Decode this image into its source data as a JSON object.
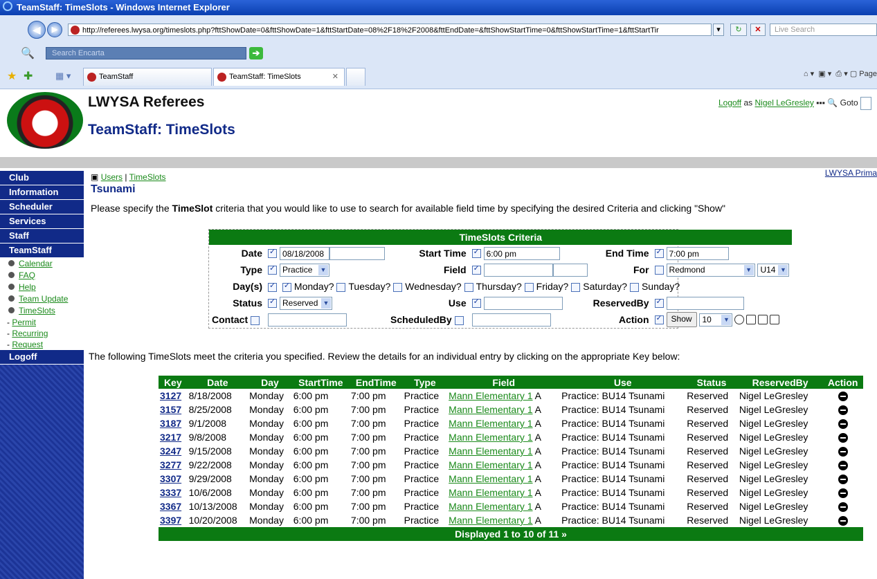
{
  "window": {
    "title": "TeamStaff: TimeSlots - Windows Internet Explorer"
  },
  "browser": {
    "url": "http://referees.lwysa.org/timeslots.php?fttShowDate=0&fttShowDate=1&fttStartDate=08%2F18%2F2008&fttEndDate=&fttShowStartTime=0&fttShowStartTime=1&fttStartTir",
    "live_search_placeholder": "Live Search",
    "encarta_placeholder": "Search Encarta",
    "tabs": [
      {
        "label": "TeamStaff"
      },
      {
        "label": "TeamStaff: TimeSlots"
      }
    ],
    "page_menu": "Page"
  },
  "header": {
    "site": "LWYSA Referees",
    "page_title": "TeamStaff: TimeSlots",
    "logoff": "Logoff",
    "as": "as",
    "user": "Nigel LeGresley",
    "goto": "Goto",
    "primary_link": "LWYSA Prima"
  },
  "sidebar": {
    "heads": [
      "Club",
      "Information",
      "Scheduler",
      "Services",
      "Staff",
      "TeamStaff"
    ],
    "items": [
      "Calendar",
      "FAQ",
      "Help",
      "Team Update",
      "TimeSlots"
    ],
    "subs": [
      "Permit",
      "Recurring",
      "Request"
    ],
    "logoff": "Logoff"
  },
  "main": {
    "crumb_users": "Users",
    "crumb_sep": "|",
    "crumb_timeslots": "TimeSlots",
    "team": "Tsunami",
    "intro_pre": "Please specify the ",
    "intro_bold": "TimeSlot",
    "intro_post": " criteria that you would like to use to search for available field time by specifying the desired Criteria and clicking \"Show\"",
    "summary": "The following TimeSlots meet the criteria you specified. Review the details for an individual entry by clicking on the appropriate Key below:"
  },
  "criteria": {
    "title": "TimeSlots Criteria",
    "date_label": "Date",
    "date_value": "08/18/2008",
    "start_label": "Start Time",
    "start_value": "6:00 pm",
    "end_label": "End Time",
    "end_value": "7:00 pm",
    "type_label": "Type",
    "type_value": "Practice",
    "field_label": "Field",
    "for_label": "For",
    "for_value": "Redmond",
    "for_age": "U14",
    "days_label": "Day(s)",
    "days": [
      "Monday?",
      "Tuesday?",
      "Wednesday?",
      "Thursday?",
      "Friday?",
      "Saturday?",
      "Sunday?"
    ],
    "status_label": "Status",
    "status_value": "Reserved",
    "use_label": "Use",
    "reservedby_label": "ReservedBy",
    "contact_label": "Contact",
    "scheduledby_label": "ScheduledBy",
    "action_label": "Action",
    "show_label": "Show",
    "count_value": "10"
  },
  "results": {
    "columns": [
      "Key",
      "Date",
      "Day",
      "StartTime",
      "EndTime",
      "Type",
      "Field",
      "Use",
      "Status",
      "ReservedBy",
      "Action"
    ],
    "rows": [
      {
        "key": "3127",
        "date": "8/18/2008",
        "day": "Monday",
        "start": "6:00 pm",
        "end": "7:00 pm",
        "type": "Practice",
        "field": "Mann Elementary 1",
        "field_suffix": " A",
        "use": "Practice: BU14 Tsunami",
        "status": "Reserved",
        "reserved_by": "Nigel LeGresley"
      },
      {
        "key": "3157",
        "date": "8/25/2008",
        "day": "Monday",
        "start": "6:00 pm",
        "end": "7:00 pm",
        "type": "Practice",
        "field": "Mann Elementary 1",
        "field_suffix": " A",
        "use": "Practice: BU14 Tsunami",
        "status": "Reserved",
        "reserved_by": "Nigel LeGresley"
      },
      {
        "key": "3187",
        "date": "9/1/2008",
        "day": "Monday",
        "start": "6:00 pm",
        "end": "7:00 pm",
        "type": "Practice",
        "field": "Mann Elementary 1",
        "field_suffix": " A",
        "use": "Practice: BU14 Tsunami",
        "status": "Reserved",
        "reserved_by": "Nigel LeGresley"
      },
      {
        "key": "3217",
        "date": "9/8/2008",
        "day": "Monday",
        "start": "6:00 pm",
        "end": "7:00 pm",
        "type": "Practice",
        "field": "Mann Elementary 1",
        "field_suffix": " A",
        "use": "Practice: BU14 Tsunami",
        "status": "Reserved",
        "reserved_by": "Nigel LeGresley"
      },
      {
        "key": "3247",
        "date": "9/15/2008",
        "day": "Monday",
        "start": "6:00 pm",
        "end": "7:00 pm",
        "type": "Practice",
        "field": "Mann Elementary 1",
        "field_suffix": " A",
        "use": "Practice: BU14 Tsunami",
        "status": "Reserved",
        "reserved_by": "Nigel LeGresley"
      },
      {
        "key": "3277",
        "date": "9/22/2008",
        "day": "Monday",
        "start": "6:00 pm",
        "end": "7:00 pm",
        "type": "Practice",
        "field": "Mann Elementary 1",
        "field_suffix": " A",
        "use": "Practice: BU14 Tsunami",
        "status": "Reserved",
        "reserved_by": "Nigel LeGresley"
      },
      {
        "key": "3307",
        "date": "9/29/2008",
        "day": "Monday",
        "start": "6:00 pm",
        "end": "7:00 pm",
        "type": "Practice",
        "field": "Mann Elementary 1",
        "field_suffix": " A",
        "use": "Practice: BU14 Tsunami",
        "status": "Reserved",
        "reserved_by": "Nigel LeGresley"
      },
      {
        "key": "3337",
        "date": "10/6/2008",
        "day": "Monday",
        "start": "6:00 pm",
        "end": "7:00 pm",
        "type": "Practice",
        "field": "Mann Elementary 1",
        "field_suffix": " A",
        "use": "Practice: BU14 Tsunami",
        "status": "Reserved",
        "reserved_by": "Nigel LeGresley"
      },
      {
        "key": "3367",
        "date": "10/13/2008",
        "day": "Monday",
        "start": "6:00 pm",
        "end": "7:00 pm",
        "type": "Practice",
        "field": "Mann Elementary 1",
        "field_suffix": " A",
        "use": "Practice: BU14 Tsunami",
        "status": "Reserved",
        "reserved_by": "Nigel LeGresley"
      },
      {
        "key": "3397",
        "date": "10/20/2008",
        "day": "Monday",
        "start": "6:00 pm",
        "end": "7:00 pm",
        "type": "Practice",
        "field": "Mann Elementary 1",
        "field_suffix": " A",
        "use": "Practice: BU14 Tsunami",
        "status": "Reserved",
        "reserved_by": "Nigel LeGresley"
      }
    ],
    "footer": "Displayed 1 to 10 of 11"
  },
  "colors": {
    "header_green": "#0b7a12",
    "nav_blue": "#112a88",
    "link_green": "#1a8a1a"
  }
}
